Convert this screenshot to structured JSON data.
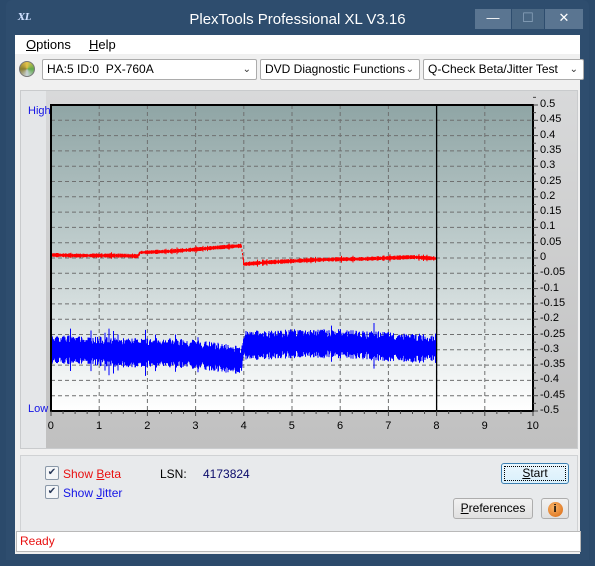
{
  "window": {
    "title": "PlexTools Professional XL V3.16",
    "app_icon": "XL",
    "controls": {
      "minimize": "—",
      "maximize": "☐",
      "close": "✕"
    }
  },
  "menu": [
    {
      "label": "Options",
      "accel": "O"
    },
    {
      "label": "Help",
      "accel": "H"
    }
  ],
  "toolbar": {
    "drive_icon": "disc-icon",
    "drive_select": "HA:5 ID:0  PX-760A",
    "function_select": "DVD Diagnostic Functions",
    "test_select": "Q-Check Beta/Jitter Test"
  },
  "chart_labels": {
    "high": "High",
    "low": "Low"
  },
  "colors": {
    "beta": "#ff0000",
    "jitter": "#0000ff",
    "status": "#e81010",
    "high_low": "#1414e6"
  },
  "chart_data": {
    "type": "line",
    "title": "",
    "xlabel": "",
    "ylabel": "",
    "xlim": [
      0,
      10
    ],
    "ylim": [
      -0.5,
      0.5
    ],
    "x_ticks": [
      "0",
      "1",
      "2",
      "3",
      "4",
      "5",
      "6",
      "7",
      "8",
      "9",
      "10"
    ],
    "y_ticks": [
      "0.5",
      "0.45",
      "0.4",
      "0.35",
      "0.3",
      "0.25",
      "0.2",
      "0.15",
      "0.1",
      "0.05",
      "0",
      "-0.05",
      "-0.1",
      "-0.15",
      "-0.2",
      "-0.25",
      "-0.3",
      "-0.35",
      "-0.4",
      "-0.45",
      "-0.5"
    ],
    "grid": true,
    "progress_marker_x": 8.0,
    "series": [
      {
        "name": "Beta",
        "color": "#ff0000",
        "x": [
          0,
          0.5,
          1.0,
          1.5,
          1.8,
          1.85,
          2.5,
          3.0,
          3.5,
          3.95,
          4.0,
          4.5,
          5.0,
          5.5,
          6.0,
          6.5,
          7.0,
          7.5,
          8.0
        ],
        "y": [
          0.01,
          0.008,
          0.008,
          0.008,
          0.006,
          0.018,
          0.022,
          0.028,
          0.035,
          0.04,
          -0.02,
          -0.014,
          -0.01,
          -0.006,
          -0.004,
          -0.003,
          0.0,
          0.003,
          -0.002
        ],
        "noise": 0.006
      },
      {
        "name": "Jitter",
        "color": "#0000ff",
        "x": [
          0,
          0.5,
          1.0,
          1.5,
          2.0,
          2.5,
          3.0,
          3.5,
          3.95,
          4.0,
          4.5,
          5.0,
          5.5,
          6.0,
          6.5,
          7.0,
          7.5,
          8.0
        ],
        "y": [
          -0.3,
          -0.3,
          -0.305,
          -0.31,
          -0.31,
          -0.31,
          -0.315,
          -0.325,
          -0.335,
          -0.285,
          -0.285,
          -0.28,
          -0.28,
          -0.28,
          -0.285,
          -0.29,
          -0.295,
          -0.295
        ],
        "noise": 0.04
      }
    ]
  },
  "controls": {
    "show_beta": {
      "label_pre": "Show ",
      "accel": "B",
      "label_post": "eta",
      "checked": true
    },
    "show_jitter": {
      "label_pre": "Show ",
      "accel": "J",
      "label_post": "itter",
      "checked": true
    },
    "lsn_label": "LSN:",
    "lsn_value": "4173824",
    "start_button": {
      "accel": "S",
      "rest": "tart"
    },
    "preferences_button": {
      "accel": "P",
      "rest": "references"
    },
    "info_icon": "i"
  },
  "status": {
    "text": "Ready"
  }
}
